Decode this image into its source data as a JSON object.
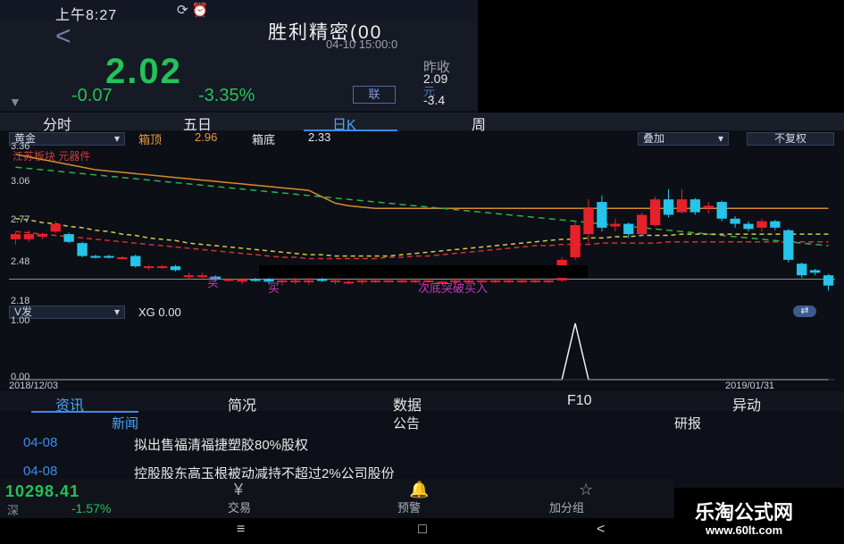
{
  "status_bar": {
    "time": "上午8:27",
    "icons": "⟳ ⏰"
  },
  "header": {
    "back": "<",
    "title": "胜利精密(00",
    "subtitle": "04-10 15:00:0",
    "price": "2.02",
    "change": "-0.07",
    "change_pct": "-3.35%",
    "lian_label": "联",
    "prev_close_label": "昨收",
    "prev_close": "2.09",
    "unit_label": "元",
    "extra": "-3.4"
  },
  "tabs": [
    {
      "label": "分时"
    },
    {
      "label": "五日"
    },
    {
      "label": "日K"
    },
    {
      "label": "周"
    }
  ],
  "chart_controls": {
    "indicator": "黄金",
    "box_top_label": "箱顶",
    "box_top_value": "2.96",
    "box_bottom_label": "箱底",
    "box_bottom_value": "2.33",
    "overlay": "叠加",
    "adjust": "不复权",
    "sector_label": "江苏板块 元器件"
  },
  "axis": {
    "y_labels": [
      "3.36",
      "3.06",
      "2.77",
      "2.48",
      "2.18"
    ],
    "date_start": "2018/12/03",
    "date_end": "2019/01/31",
    "vol_labels": [
      "1.00",
      "0.00"
    ]
  },
  "annotations": [
    "买",
    "买",
    "次底突破买入"
  ],
  "lower_panel": {
    "indicator": "V发",
    "value_label": "XG 0.00"
  },
  "colors": {
    "up": "#e8202a",
    "down": "#25c4e8",
    "green": "#23c25a",
    "accent": "#3c8cf0"
  },
  "candles": [
    {
      "o": 2.66,
      "c": 2.7,
      "h": 2.72,
      "l": 2.62
    },
    {
      "o": 2.66,
      "c": 2.7,
      "h": 2.73,
      "l": 2.64
    },
    {
      "o": 2.68,
      "c": 2.7,
      "h": 2.71,
      "l": 2.66
    },
    {
      "o": 2.72,
      "c": 2.78,
      "h": 2.8,
      "l": 2.71
    },
    {
      "o": 2.7,
      "c": 2.64,
      "h": 2.71,
      "l": 2.63
    },
    {
      "o": 2.63,
      "c": 2.53,
      "h": 2.64,
      "l": 2.52
    },
    {
      "o": 2.53,
      "c": 2.52,
      "h": 2.54,
      "l": 2.51
    },
    {
      "o": 2.53,
      "c": 2.52,
      "h": 2.54,
      "l": 2.51
    },
    {
      "o": 2.52,
      "c": 2.52,
      "h": 2.53,
      "l": 2.51
    },
    {
      "o": 2.53,
      "c": 2.45,
      "h": 2.54,
      "l": 2.44
    },
    {
      "o": 2.45,
      "c": 2.45,
      "h": 2.46,
      "l": 2.42
    },
    {
      "o": 2.45,
      "c": 2.45,
      "h": 2.46,
      "l": 2.43
    },
    {
      "o": 2.45,
      "c": 2.42,
      "h": 2.46,
      "l": 2.41
    },
    {
      "o": 2.38,
      "c": 2.38,
      "h": 2.4,
      "l": 2.35
    },
    {
      "o": 2.38,
      "c": 2.38,
      "h": 2.4,
      "l": 2.36
    },
    {
      "o": 2.37,
      "c": 2.35,
      "h": 2.38,
      "l": 2.33
    },
    {
      "o": 2.34,
      "c": 2.35,
      "h": 2.36,
      "l": 2.33
    },
    {
      "o": 2.33,
      "c": 2.35,
      "h": 2.36,
      "l": 2.31
    },
    {
      "o": 2.35,
      "c": 2.34,
      "h": 2.36,
      "l": 2.33
    },
    {
      "o": 2.35,
      "c": 2.33,
      "h": 2.36,
      "l": 2.31
    },
    {
      "o": 2.33,
      "c": 2.34,
      "h": 2.35,
      "l": 2.3
    },
    {
      "o": 2.33,
      "c": 2.34,
      "h": 2.36,
      "l": 2.31
    },
    {
      "o": 2.33,
      "c": 2.34,
      "h": 2.36,
      "l": 2.31
    },
    {
      "o": 2.35,
      "c": 2.34,
      "h": 2.36,
      "l": 2.33
    },
    {
      "o": 2.33,
      "c": 2.34,
      "h": 2.35,
      "l": 2.31
    },
    {
      "o": 2.33,
      "c": 2.33,
      "h": 2.34,
      "l": 2.31
    },
    {
      "o": 2.33,
      "c": 2.34,
      "h": 2.35,
      "l": 2.31
    },
    {
      "o": 2.33,
      "c": 2.34,
      "h": 2.35,
      "l": 2.32
    },
    {
      "o": 2.34,
      "c": 2.34,
      "h": 2.35,
      "l": 2.33
    },
    {
      "o": 2.33,
      "c": 2.34,
      "h": 2.35,
      "l": 2.32
    },
    {
      "o": 2.33,
      "c": 2.34,
      "h": 2.35,
      "l": 2.32
    },
    {
      "o": 2.34,
      "c": 2.34,
      "h": 2.35,
      "l": 2.32
    },
    {
      "o": 2.33,
      "c": 2.33,
      "h": 2.34,
      "l": 2.31
    },
    {
      "o": 2.33,
      "c": 2.34,
      "h": 2.35,
      "l": 2.32
    },
    {
      "o": 2.33,
      "c": 2.34,
      "h": 2.35,
      "l": 2.32
    },
    {
      "o": 2.33,
      "c": 2.34,
      "h": 2.35,
      "l": 2.32
    },
    {
      "o": 2.33,
      "c": 2.34,
      "h": 2.35,
      "l": 2.32
    },
    {
      "o": 2.33,
      "c": 2.34,
      "h": 2.35,
      "l": 2.32
    },
    {
      "o": 2.33,
      "c": 2.34,
      "h": 2.35,
      "l": 2.32
    },
    {
      "o": 2.33,
      "c": 2.34,
      "h": 2.35,
      "l": 2.32
    },
    {
      "o": 2.33,
      "c": 2.34,
      "h": 2.35,
      "l": 2.32
    },
    {
      "o": 2.34,
      "c": 2.5,
      "h": 2.52,
      "l": 2.33
    },
    {
      "o": 2.52,
      "c": 2.77,
      "h": 2.79,
      "l": 2.5
    },
    {
      "o": 2.7,
      "c": 2.9,
      "h": 2.97,
      "l": 2.63
    },
    {
      "o": 2.95,
      "c": 2.75,
      "h": 3.0,
      "l": 2.72
    },
    {
      "o": 2.76,
      "c": 2.78,
      "h": 2.82,
      "l": 2.72
    },
    {
      "o": 2.78,
      "c": 2.7,
      "h": 2.79,
      "l": 2.67
    },
    {
      "o": 2.7,
      "c": 2.85,
      "h": 2.87,
      "l": 2.69
    },
    {
      "o": 2.77,
      "c": 2.97,
      "h": 2.99,
      "l": 2.76
    },
    {
      "o": 2.97,
      "c": 2.85,
      "h": 3.05,
      "l": 2.83
    },
    {
      "o": 2.87,
      "c": 2.97,
      "h": 3.05,
      "l": 2.86
    },
    {
      "o": 2.97,
      "c": 2.87,
      "h": 2.98,
      "l": 2.85
    },
    {
      "o": 2.9,
      "c": 2.92,
      "h": 2.95,
      "l": 2.86
    },
    {
      "o": 2.95,
      "c": 2.82,
      "h": 2.96,
      "l": 2.8
    },
    {
      "o": 2.82,
      "c": 2.78,
      "h": 2.84,
      "l": 2.75
    },
    {
      "o": 2.78,
      "c": 2.74,
      "h": 2.8,
      "l": 2.72
    },
    {
      "o": 2.75,
      "c": 2.8,
      "h": 2.82,
      "l": 2.72
    },
    {
      "o": 2.8,
      "c": 2.75,
      "h": 2.81,
      "l": 2.73
    },
    {
      "o": 2.73,
      "c": 2.5,
      "h": 2.74,
      "l": 2.48
    },
    {
      "o": 2.47,
      "c": 2.38,
      "h": 2.48,
      "l": 2.36
    },
    {
      "o": 2.42,
      "c": 2.4,
      "h": 2.43,
      "l": 2.38
    },
    {
      "o": 2.38,
      "c": 2.3,
      "h": 2.39,
      "l": 2.26
    }
  ],
  "ma_orange": [
    3.32,
    3.3,
    3.28,
    3.26,
    3.24,
    3.22,
    3.2,
    3.19,
    3.18,
    3.17,
    3.16,
    3.15,
    3.14,
    3.13,
    3.12,
    3.11,
    3.1,
    3.09,
    3.08,
    3.07,
    3.06,
    3.05,
    3.04,
    2.99,
    2.94,
    2.92,
    2.91,
    2.9,
    2.9,
    2.9,
    2.9,
    2.9,
    2.9,
    2.9,
    2.9,
    2.9,
    2.9,
    2.9,
    2.9,
    2.9,
    2.9,
    2.9,
    2.9,
    2.9,
    2.9,
    2.9,
    2.9,
    2.9,
    2.9,
    2.9,
    2.9,
    2.9,
    2.9,
    2.9,
    2.9,
    2.9,
    2.9,
    2.9,
    2.9,
    2.9,
    2.9,
    2.9
  ],
  "ma_green": [
    3.22,
    3.21,
    3.2,
    3.19,
    3.18,
    3.17,
    3.16,
    3.15,
    3.14,
    3.13,
    3.12,
    3.11,
    3.1,
    3.09,
    3.08,
    3.07,
    3.06,
    3.05,
    3.04,
    3.03,
    3.02,
    3.01,
    3.0,
    2.99,
    2.98,
    2.97,
    2.96,
    2.95,
    2.94,
    2.93,
    2.92,
    2.91,
    2.9,
    2.89,
    2.88,
    2.87,
    2.86,
    2.85,
    2.84,
    2.83,
    2.82,
    2.81,
    2.8,
    2.79,
    2.78,
    2.77,
    2.76,
    2.75,
    2.74,
    2.73,
    2.72,
    2.71,
    2.7,
    2.69,
    2.68,
    2.67,
    2.66,
    2.65,
    2.64,
    2.63,
    2.62,
    2.61
  ],
  "ma_yellow": [
    2.82,
    2.81,
    2.79,
    2.78,
    2.76,
    2.75,
    2.73,
    2.72,
    2.7,
    2.69,
    2.67,
    2.66,
    2.65,
    2.63,
    2.62,
    2.61,
    2.6,
    2.59,
    2.58,
    2.57,
    2.56,
    2.55,
    2.54,
    2.54,
    2.53,
    2.53,
    2.53,
    2.53,
    2.53,
    2.54,
    2.55,
    2.56,
    2.57,
    2.58,
    2.59,
    2.6,
    2.61,
    2.62,
    2.63,
    2.64,
    2.65,
    2.66,
    2.66,
    2.67,
    2.67,
    2.68,
    2.68,
    2.69,
    2.69,
    2.69,
    2.7,
    2.7,
    2.7,
    2.7,
    2.7,
    2.7,
    2.7,
    2.7,
    2.7,
    2.7,
    2.7,
    2.7
  ],
  "ma_red": [
    2.72,
    2.71,
    2.7,
    2.69,
    2.68,
    2.67,
    2.66,
    2.65,
    2.64,
    2.63,
    2.62,
    2.61,
    2.6,
    2.59,
    2.58,
    2.57,
    2.56,
    2.55,
    2.54,
    2.53,
    2.52,
    2.52,
    2.51,
    2.51,
    2.51,
    2.51,
    2.51,
    2.51,
    2.52,
    2.52,
    2.53,
    2.53,
    2.54,
    2.55,
    2.56,
    2.57,
    2.58,
    2.59,
    2.6,
    2.61,
    2.61,
    2.62,
    2.62,
    2.62,
    2.63,
    2.63,
    2.63,
    2.63,
    2.63,
    2.64,
    2.64,
    2.64,
    2.64,
    2.64,
    2.64,
    2.64,
    2.64,
    2.64,
    2.64,
    2.64,
    2.64,
    2.64
  ],
  "signal": [
    0,
    0,
    0,
    0,
    0,
    0,
    0,
    0,
    0,
    0,
    0,
    0,
    0,
    0,
    0,
    0,
    0,
    0,
    0,
    0,
    0,
    0,
    0,
    0,
    0,
    0,
    0,
    0,
    0,
    0,
    0,
    0,
    0,
    0,
    0,
    0,
    0,
    0,
    0,
    0,
    0,
    0,
    1,
    0,
    0,
    0,
    0,
    0,
    0,
    0,
    0,
    0,
    0,
    0,
    0,
    0,
    0,
    0,
    0,
    0,
    0,
    0
  ],
  "nav_tabs": [
    {
      "label": "资讯"
    },
    {
      "label": "简况"
    },
    {
      "label": "数据"
    },
    {
      "label": "F10"
    },
    {
      "label": "异动"
    }
  ],
  "sub_tabs": [
    {
      "label": "新闻"
    },
    {
      "label": "公告"
    },
    {
      "label": "研报"
    }
  ],
  "news": [
    {
      "date": "04-08",
      "title": "拟出售福清福捷塑胶80%股权"
    },
    {
      "date": "04-08",
      "title": "控股股东高玉根被动减持不超过2%公司股份"
    }
  ],
  "bottom": {
    "index_value": "10298.41",
    "index_label": "深",
    "index_pct": "-1.57%",
    "buttons": [
      {
        "icon": "¥",
        "label": "交易"
      },
      {
        "icon": "🔔",
        "label": "预警"
      },
      {
        "icon": "☆",
        "label": "加分组"
      }
    ]
  },
  "system_nav": {
    "menu": "≡",
    "home": "□",
    "back": "<"
  },
  "watermark": {
    "title": "乐淘公式网",
    "url": "www.60lt.com"
  }
}
